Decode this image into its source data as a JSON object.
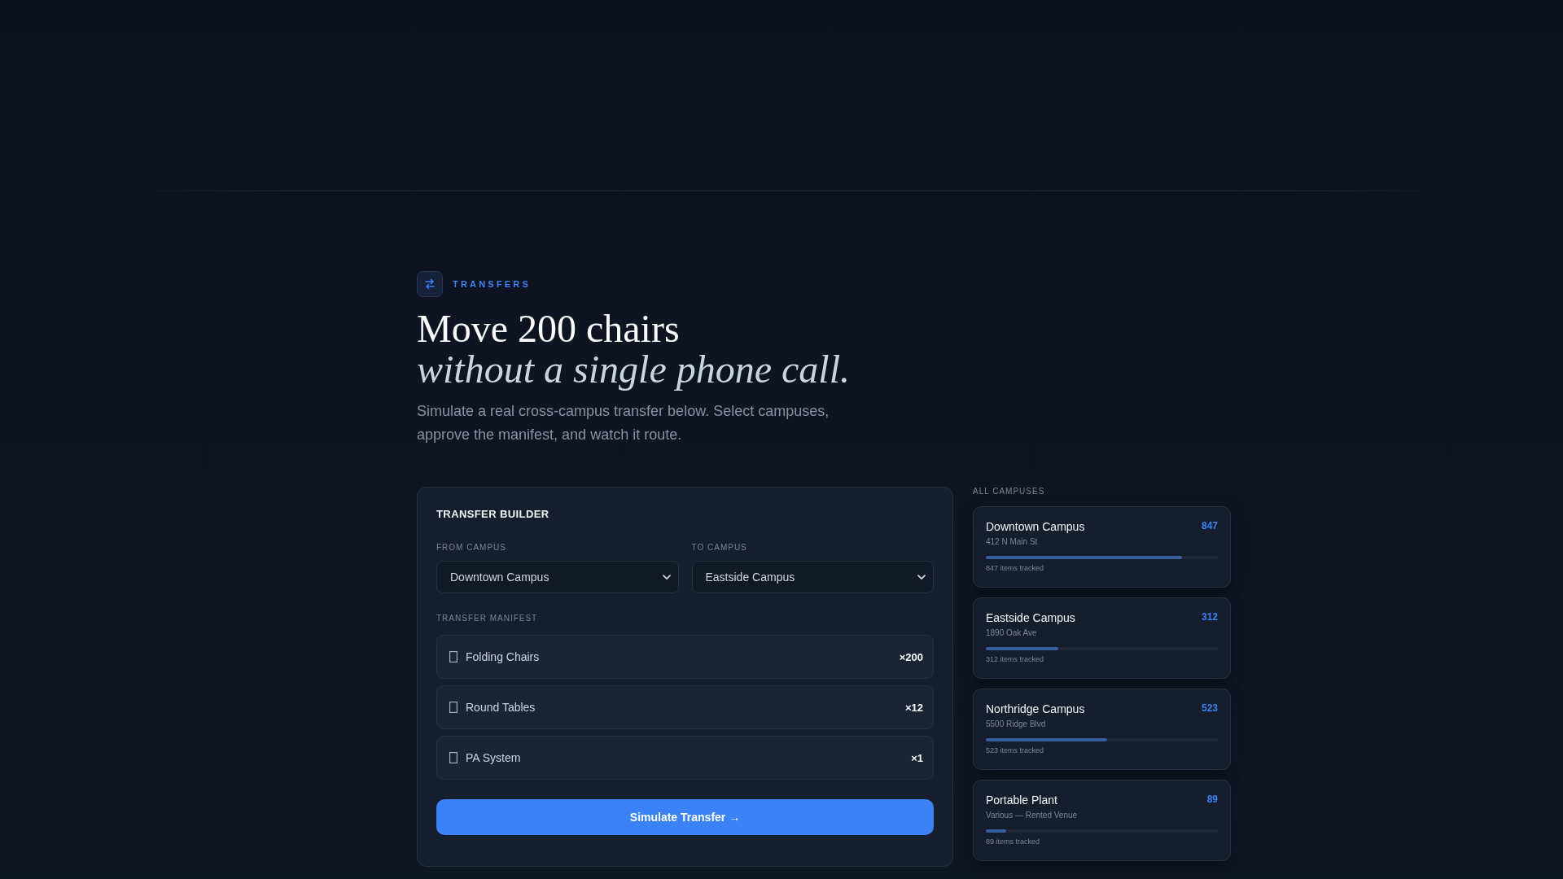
{
  "header": {
    "badge": "TRANSFERS",
    "title": "Move 200 chairs",
    "title_italic": "without a single phone call.",
    "subtitle": "Simulate a real cross-campus transfer below. Select campuses, approve the manifest, and watch it route."
  },
  "builder": {
    "title": "TRANSFER BUILDER",
    "from": {
      "label": "FROM CAMPUS",
      "value": "Downtown Campus"
    },
    "to": {
      "label": "TO CAMPUS",
      "value": "Eastside Campus"
    },
    "manifest_label": "TRANSFER MANIFEST",
    "items": [
      {
        "name": "Folding Chairs",
        "quantity": "×200"
      },
      {
        "name": "Round Tables",
        "quantity": "×12"
      },
      {
        "name": "PA System",
        "quantity": "×1"
      }
    ],
    "button": "Simulate Transfer →"
  },
  "campuses": {
    "label": "ALL CAMPUSES",
    "items": [
      {
        "name": "Downtown Campus",
        "address": "412 N Main St",
        "count": "847",
        "level": 0.847,
        "note": "847 items tracked"
      },
      {
        "name": "Eastside Campus",
        "address": "1890 Oak Ave",
        "count": "312",
        "level": 0.312,
        "note": "312 items tracked"
      },
      {
        "name": "Northridge Campus",
        "address": "5500 Ridge Blvd",
        "count": "523",
        "level": 0.523,
        "note": "523 items tracked"
      },
      {
        "name": "Portable Plant",
        "address": "Various — Rented Venue",
        "count": "89",
        "level": 0.089,
        "note": "89 items tracked"
      }
    ]
  }
}
